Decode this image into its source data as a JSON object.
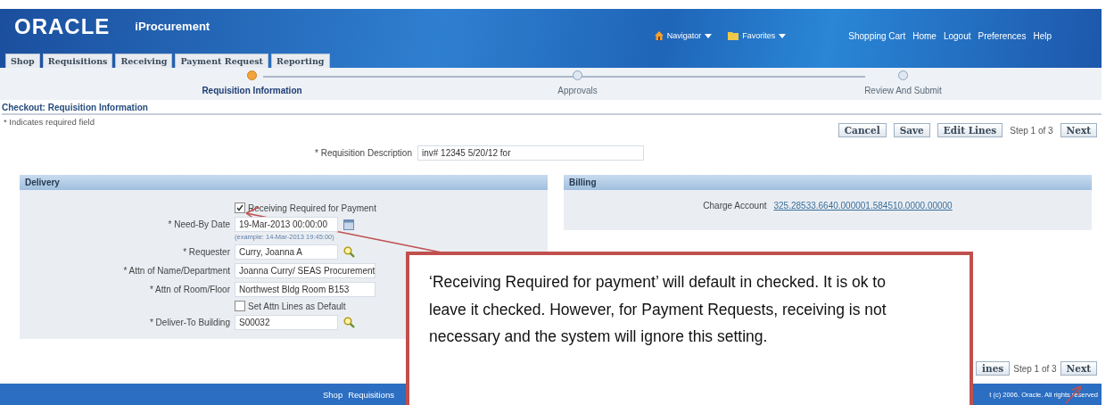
{
  "header": {
    "logo": "ORACLE",
    "product": "iProcurement",
    "menus": [
      {
        "label": "Navigator",
        "kind": "navigator"
      },
      {
        "label": "Favorites",
        "kind": "favorites"
      }
    ],
    "links": [
      "Shopping Cart",
      "Home",
      "Logout",
      "Preferences",
      "Help"
    ]
  },
  "tabs": [
    {
      "label": "Shop",
      "selected": false
    },
    {
      "label": "Requisitions",
      "selected": false
    },
    {
      "label": "Receiving",
      "selected": false
    },
    {
      "label": "Payment Request",
      "selected": false
    },
    {
      "label": "Reporting",
      "selected": false
    }
  ],
  "steps": [
    {
      "label": "Requisition Information",
      "selected": true
    },
    {
      "label": "Approvals",
      "selected": false
    },
    {
      "label": "Review And Submit",
      "selected": false
    }
  ],
  "page_title": "Checkout: Requisition Information",
  "required_note": "* Indicates required field",
  "top_buttons": [
    "Cancel",
    "Save",
    "Edit Lines"
  ],
  "step_text": "Step 1 of 3",
  "next_button": "Next",
  "description": {
    "label": "* Requisition Description",
    "value": "inv# 12345 5/20/12 for"
  },
  "delivery": {
    "title": "Delivery",
    "rows": [
      {
        "kind": "checkbox",
        "label": "Receiving Required for Payment",
        "checked": true
      },
      {
        "kind": "field",
        "label": "* Need-By Date",
        "value": "19-Mar-2013 00:00:00",
        "calendar": true,
        "hint": "(example: 14-Mar-2013 19:45:00)"
      },
      {
        "kind": "field",
        "label": "* Requester",
        "value": "Curry, Joanna A",
        "lookup": true
      },
      {
        "kind": "field",
        "label": "* Attn of Name/Department",
        "value": "Joanna Curry/ SEAS Procurement"
      },
      {
        "kind": "field",
        "label": "* Attn of Room/Floor",
        "value": "Northwest Bldg Room B153"
      },
      {
        "kind": "checkbox",
        "label": "Set Attn Lines as Default",
        "checked": false
      },
      {
        "kind": "field",
        "label": "* Deliver-To Building",
        "value": "S00032",
        "lookup": true
      }
    ]
  },
  "billing": {
    "title": "Billing",
    "label": "Charge Account",
    "value": "325.28533.6640.000001.584510.0000.00000"
  },
  "bottom_buttons": [
    "ines"
  ],
  "bottom_step_text": "Step 1 of 3",
  "bottom_next_button": "Next",
  "footer": {
    "links": [
      "Shop",
      "Requisitions"
    ],
    "copyright": "t (c) 2006. Oracle. All rights reserved"
  },
  "callout": "‘Receiving Required for payment’ will default in checked.  It is ok to leave it checked.  However, for Payment Requests, receiving is not necessary and the system will ignore this setting."
}
